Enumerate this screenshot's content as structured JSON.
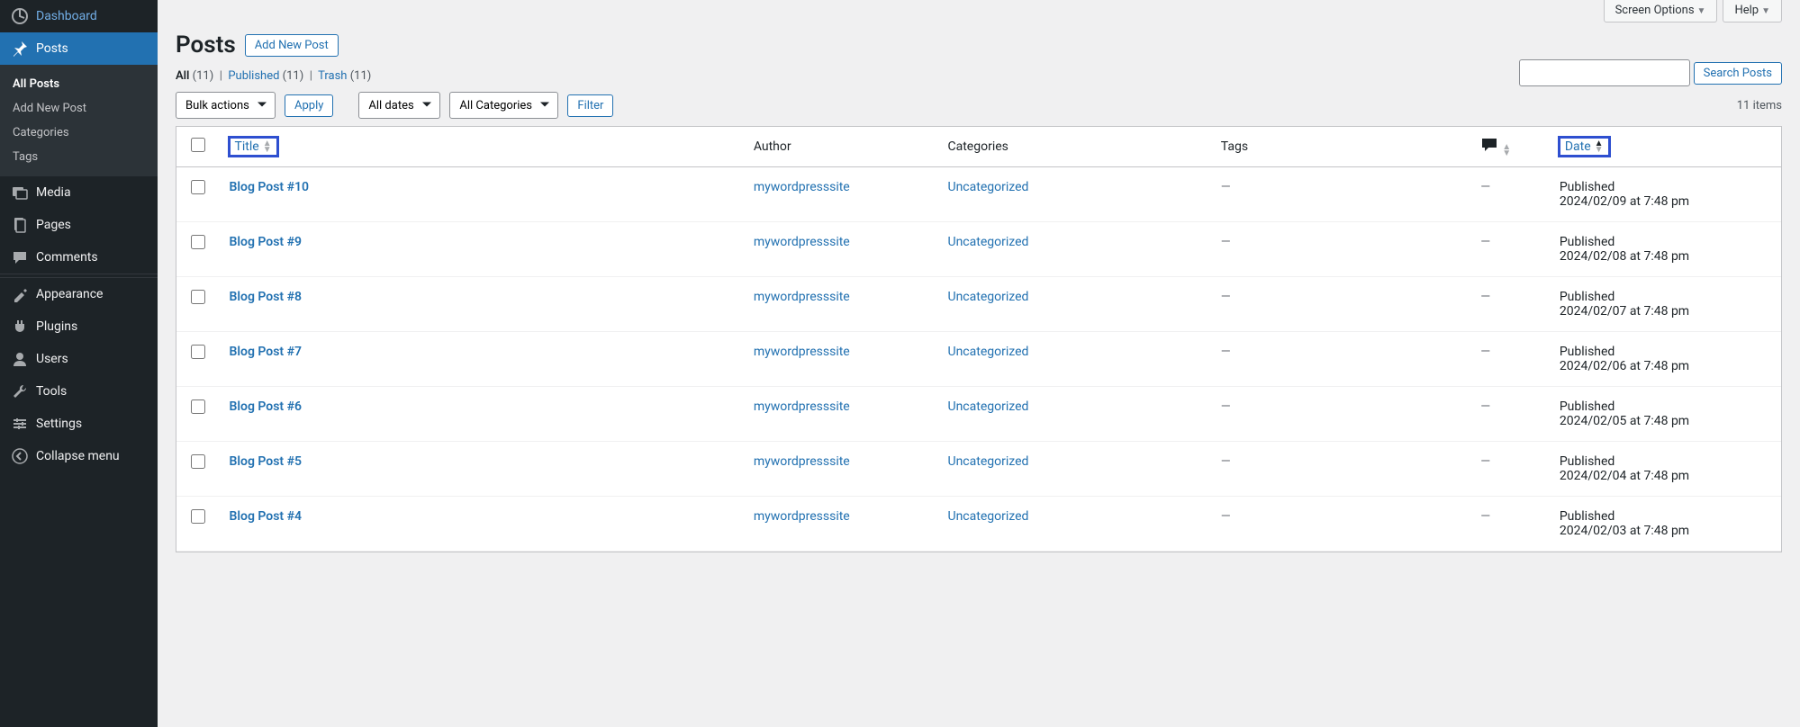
{
  "sidebar": {
    "dashboard": "Dashboard",
    "posts": "Posts",
    "sub": {
      "all": "All Posts",
      "add": "Add New Post",
      "cats": "Categories",
      "tags": "Tags"
    },
    "media": "Media",
    "pages": "Pages",
    "comments": "Comments",
    "appearance": "Appearance",
    "plugins": "Plugins",
    "users": "Users",
    "tools": "Tools",
    "settings": "Settings",
    "collapse": "Collapse menu"
  },
  "screen_options": "Screen Options",
  "help": "Help",
  "page_title": "Posts",
  "add_new": "Add New Post",
  "filters": {
    "all_label": "All",
    "all_count": "(11)",
    "published_label": "Published",
    "published_count": "(11)",
    "trash_label": "Trash",
    "trash_count": "(11)"
  },
  "search_btn": "Search Posts",
  "bulk_actions": "Bulk actions",
  "apply": "Apply",
  "all_dates": "All dates",
  "all_cats": "All Categories",
  "filter_btn": "Filter",
  "items_count": "11 items",
  "cols": {
    "title": "Title",
    "author": "Author",
    "categories": "Categories",
    "tags": "Tags",
    "date": "Date"
  },
  "rows": [
    {
      "title": "Blog Post #10",
      "author": "mywordpresssite",
      "cat": "Uncategorized",
      "tags": "—",
      "comments": "—",
      "status": "Published",
      "date": "2024/02/09 at 7:48 pm"
    },
    {
      "title": "Blog Post #9",
      "author": "mywordpresssite",
      "cat": "Uncategorized",
      "tags": "—",
      "comments": "—",
      "status": "Published",
      "date": "2024/02/08 at 7:48 pm"
    },
    {
      "title": "Blog Post #8",
      "author": "mywordpresssite",
      "cat": "Uncategorized",
      "tags": "—",
      "comments": "—",
      "status": "Published",
      "date": "2024/02/07 at 7:48 pm"
    },
    {
      "title": "Blog Post #7",
      "author": "mywordpresssite",
      "cat": "Uncategorized",
      "tags": "—",
      "comments": "—",
      "status": "Published",
      "date": "2024/02/06 at 7:48 pm"
    },
    {
      "title": "Blog Post #6",
      "author": "mywordpresssite",
      "cat": "Uncategorized",
      "tags": "—",
      "comments": "—",
      "status": "Published",
      "date": "2024/02/05 at 7:48 pm"
    },
    {
      "title": "Blog Post #5",
      "author": "mywordpresssite",
      "cat": "Uncategorized",
      "tags": "—",
      "comments": "—",
      "status": "Published",
      "date": "2024/02/04 at 7:48 pm"
    },
    {
      "title": "Blog Post #4",
      "author": "mywordpresssite",
      "cat": "Uncategorized",
      "tags": "—",
      "comments": "—",
      "status": "Published",
      "date": "2024/02/03 at 7:48 pm"
    }
  ]
}
